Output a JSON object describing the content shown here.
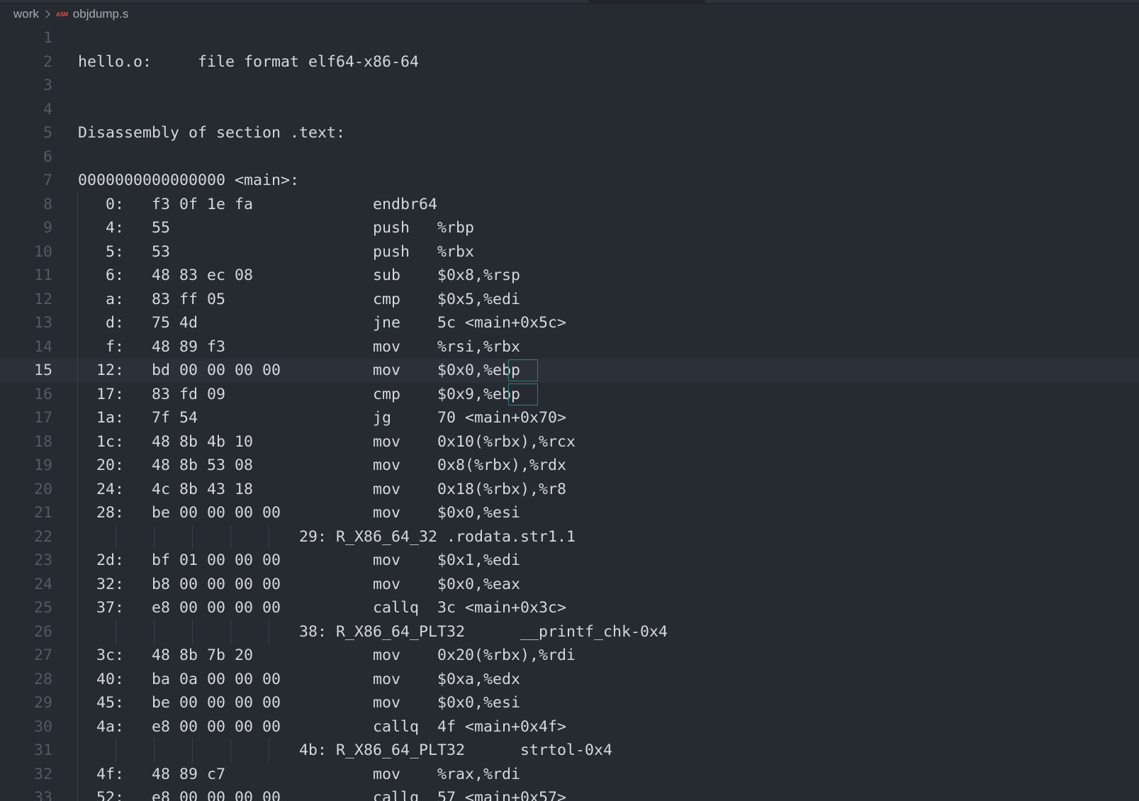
{
  "breadcrumb": {
    "folder": "work",
    "file_icon": "ASM",
    "file": "objdump.s"
  },
  "editor": {
    "current_line": 15,
    "lines": [
      {
        "n": "1",
        "text": ""
      },
      {
        "n": "2",
        "text": "hello.o:     file format elf64-x86-64"
      },
      {
        "n": "3",
        "text": ""
      },
      {
        "n": "4",
        "text": ""
      },
      {
        "n": "5",
        "text": "Disassembly of section .text:"
      },
      {
        "n": "6",
        "text": ""
      },
      {
        "n": "7",
        "text": "0000000000000000 <main>:"
      },
      {
        "n": "8",
        "text": "   0:\tf3 0f 1e fa          \tendbr64 "
      },
      {
        "n": "9",
        "text": "   4:\t55                   \tpush   %rbp"
      },
      {
        "n": "10",
        "text": "   5:\t53                   \tpush   %rbx"
      },
      {
        "n": "11",
        "text": "   6:\t48 83 ec 08          \tsub    $0x8,%rsp"
      },
      {
        "n": "12",
        "text": "   a:\t83 ff 05             \tcmp    $0x5,%edi"
      },
      {
        "n": "13",
        "text": "   d:\t75 4d                \tjne    5c <main+0x5c>"
      },
      {
        "n": "14",
        "text": "   f:\t48 89 f3             \tmov    %rsi,%rbx"
      },
      {
        "n": "15",
        "text": "  12:\tbd 00 00 00 00       \tmov    $0x0,%ebp"
      },
      {
        "n": "16",
        "text": "  17:\t83 fd 09             \tcmp    $0x9,%ebp"
      },
      {
        "n": "17",
        "text": "  1a:\t7f 54                \tjg     70 <main+0x70>"
      },
      {
        "n": "18",
        "text": "  1c:\t48 8b 4b 10          \tmov    0x10(%rbx),%rcx"
      },
      {
        "n": "19",
        "text": "  20:\t48 8b 53 08          \tmov    0x8(%rbx),%rdx"
      },
      {
        "n": "20",
        "text": "  24:\t4c 8b 43 18          \tmov    0x18(%rbx),%r8"
      },
      {
        "n": "21",
        "text": "  28:\tbe 00 00 00 00       \tmov    $0x0,%esi"
      },
      {
        "n": "22",
        "text": "\t\t\t29: R_X86_64_32\t.rodata.str1.1"
      },
      {
        "n": "23",
        "text": "  2d:\tbf 01 00 00 00       \tmov    $0x1,%edi"
      },
      {
        "n": "24",
        "text": "  32:\tb8 00 00 00 00       \tmov    $0x0,%eax"
      },
      {
        "n": "25",
        "text": "  37:\te8 00 00 00 00       \tcallq  3c <main+0x3c>"
      },
      {
        "n": "26",
        "text": "\t\t\t38: R_X86_64_PLT32\t__printf_chk-0x4"
      },
      {
        "n": "27",
        "text": "  3c:\t48 8b 7b 20          \tmov    0x20(%rbx),%rdi"
      },
      {
        "n": "28",
        "text": "  40:\tba 0a 00 00 00       \tmov    $0xa,%edx"
      },
      {
        "n": "29",
        "text": "  45:\tbe 00 00 00 00       \tmov    $0x0,%esi"
      },
      {
        "n": "30",
        "text": "  4a:\te8 00 00 00 00       \tcallq  4f <main+0x4f>"
      },
      {
        "n": "31",
        "text": "\t\t\t4b: R_X86_64_PLT32\tstrtol-0x4"
      },
      {
        "n": "32",
        "text": "  4f:\t48 89 c7             \tmov    %rax,%rdi"
      },
      {
        "n": "33",
        "text": "  52:\te8 00 00 00 00       \tcallq  57 <main+0x57>"
      }
    ]
  }
}
